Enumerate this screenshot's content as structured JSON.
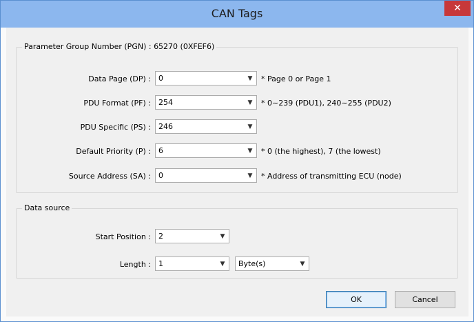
{
  "window": {
    "title": "CAN Tags",
    "close_glyph": "✕"
  },
  "pgn_group": {
    "title": "Parameter Group Number (PGN) : 65270 (0XFEF6)",
    "rows": [
      {
        "label": "Data Page (DP) :",
        "value": "0",
        "note": "* Page 0 or Page 1"
      },
      {
        "label": "PDU Format (PF) :",
        "value": "254",
        "note": "* 0~239 (PDU1), 240~255 (PDU2)"
      },
      {
        "label": "PDU Specific (PS) :",
        "value": "246",
        "note": ""
      },
      {
        "label": "Default Priority (P) :",
        "value": "6",
        "note": "* 0 (the highest), 7 (the lowest)"
      },
      {
        "label": "Source Address (SA) :",
        "value": "0",
        "note": "* Address of transmitting ECU (node)"
      }
    ]
  },
  "data_source": {
    "title": "Data source",
    "start_position_label": "Start Position :",
    "start_position_value": "2",
    "length_label": "Length :",
    "length_value": "1",
    "unit_value": "Byte(s)"
  },
  "buttons": {
    "ok": "OK",
    "cancel": "Cancel"
  },
  "icons": {
    "dropdown": "chevron-down-icon",
    "close": "close-icon"
  }
}
